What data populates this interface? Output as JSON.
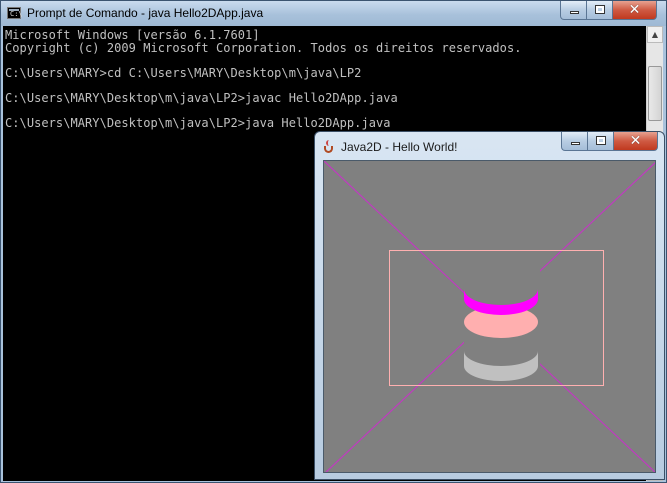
{
  "cmd": {
    "title": "Prompt de Comando - java  Hello2DApp.java",
    "icon_text": "C:\\",
    "console_lines": [
      "Microsoft Windows [versão 6.1.7601]",
      "Copyright (c) 2009 Microsoft Corporation. Todos os direitos reservados.",
      "",
      "C:\\Users\\MARY>cd C:\\Users\\MARY\\Desktop\\m\\java\\LP2",
      "",
      "C:\\Users\\MARY\\Desktop\\m\\java\\LP2>javac Hello2DApp.java",
      "",
      "C:\\Users\\MARY\\Desktop\\m\\java\\LP2>java Hello2DApp.java"
    ],
    "close_glyph": "✕"
  },
  "java_window": {
    "title": "Java2D - Hello World!",
    "close_glyph": "✕",
    "colors": {
      "background": "#808080",
      "diagonals": "#c03ac0",
      "rect_outline": "#ffb0b0",
      "top_arc": "#ff00ff",
      "middle_ellipse": "#ffafaf",
      "bottom_arc": "#c0c0c0"
    }
  },
  "icons": {
    "minimize": "minimize-icon",
    "maximize": "maximize-icon",
    "close": "close-icon",
    "cmd_app": "terminal-icon",
    "java_app": "java-cup-icon"
  }
}
